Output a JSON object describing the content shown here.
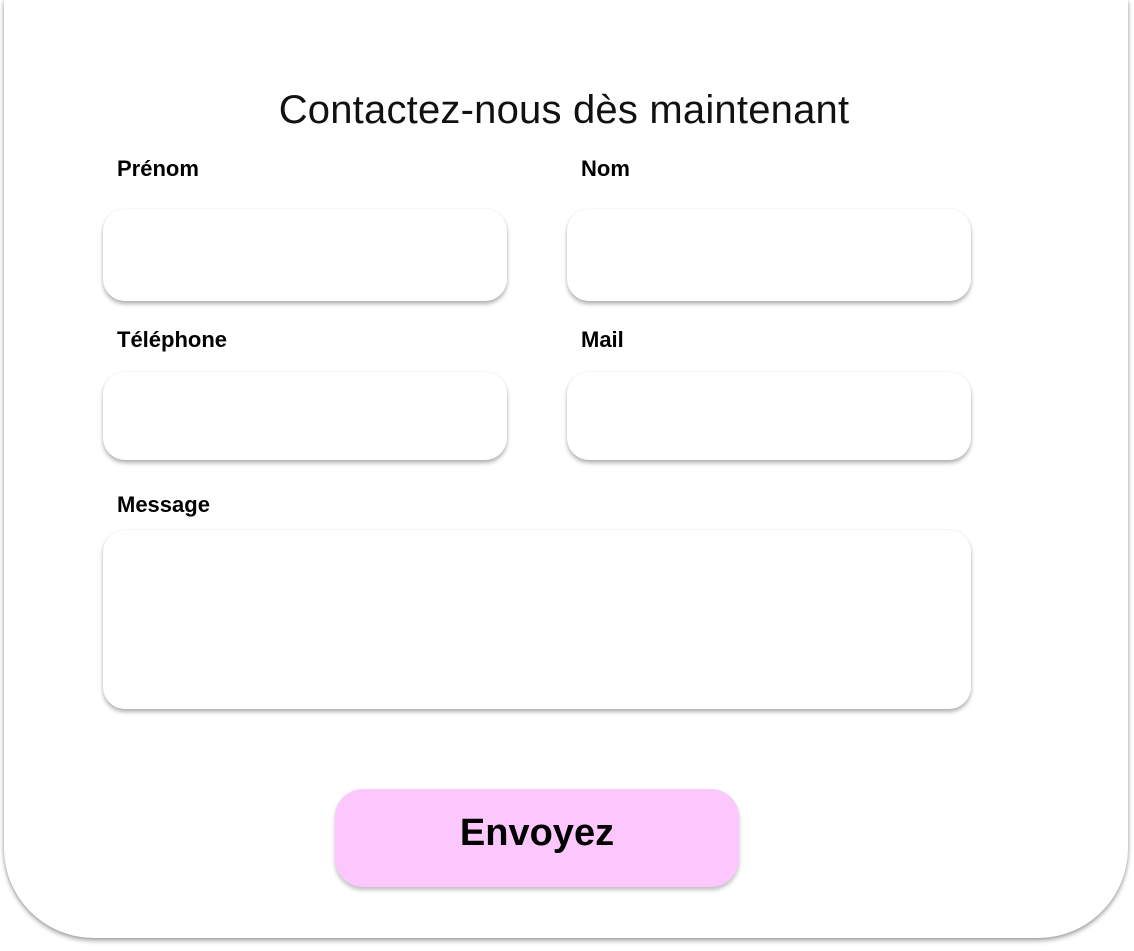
{
  "form": {
    "title": "Contactez-nous dès maintenant",
    "fields": {
      "first_name": {
        "label": "Prénom",
        "value": "",
        "placeholder": ""
      },
      "last_name": {
        "label": "Nom",
        "value": "",
        "placeholder": ""
      },
      "phone": {
        "label": "Téléphone",
        "value": "",
        "placeholder": ""
      },
      "email": {
        "label": "Mail",
        "value": "",
        "placeholder": ""
      },
      "message": {
        "label": "Message",
        "value": "",
        "placeholder": ""
      }
    },
    "submit_label": "Envoyez"
  },
  "colors": {
    "button_background": "#fcc7fd",
    "card_background": "#ffffff",
    "text": "#000000"
  }
}
